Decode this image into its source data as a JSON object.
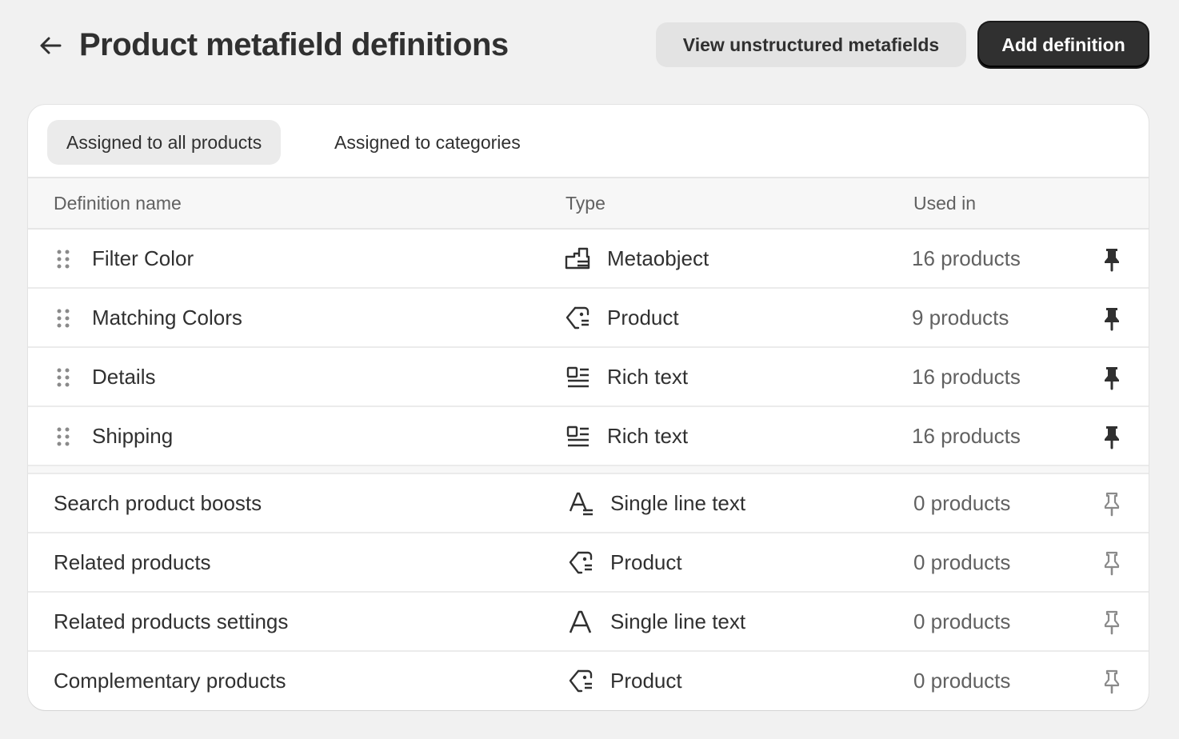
{
  "header": {
    "title": "Product metafield definitions",
    "back_icon": "arrow-left-icon",
    "view_button": "View unstructured metafields",
    "add_button": "Add definition"
  },
  "tabs": [
    {
      "label": "Assigned to all products",
      "active": true
    },
    {
      "label": "Assigned to categories",
      "active": false
    }
  ],
  "table": {
    "columns": [
      "Definition name",
      "Type",
      "Used in"
    ],
    "pinned_rows": [
      {
        "name": "Filter Color",
        "type": "Metaobject",
        "type_icon": "metaobject-icon",
        "used": "16 products",
        "pinned": true
      },
      {
        "name": "Matching Colors",
        "type": "Product",
        "type_icon": "product-icon",
        "used": "9 products",
        "pinned": true
      },
      {
        "name": "Details",
        "type": "Rich text",
        "type_icon": "rich-text-icon",
        "used": "16 products",
        "pinned": true
      },
      {
        "name": "Shipping",
        "type": "Rich text",
        "type_icon": "rich-text-icon",
        "used": "16 products",
        "pinned": true
      }
    ],
    "unpinned_rows": [
      {
        "name": "Search product boosts",
        "type": "Single line text",
        "type_icon": "single-line-text-list-icon",
        "used": "0 products",
        "pinned": false
      },
      {
        "name": "Related products",
        "type": "Product",
        "type_icon": "product-icon",
        "used": "0 products",
        "pinned": false
      },
      {
        "name": "Related products settings",
        "type": "Single line text",
        "type_icon": "single-line-text-icon",
        "used": "0 products",
        "pinned": false
      },
      {
        "name": "Complementary products",
        "type": "Product",
        "type_icon": "product-icon",
        "used": "0 products",
        "pinned": false
      }
    ]
  },
  "colors": {
    "background": "#f1f1f1",
    "card": "#ffffff",
    "primary_button": "#303030",
    "text": "#303030",
    "muted_text": "#616161"
  }
}
